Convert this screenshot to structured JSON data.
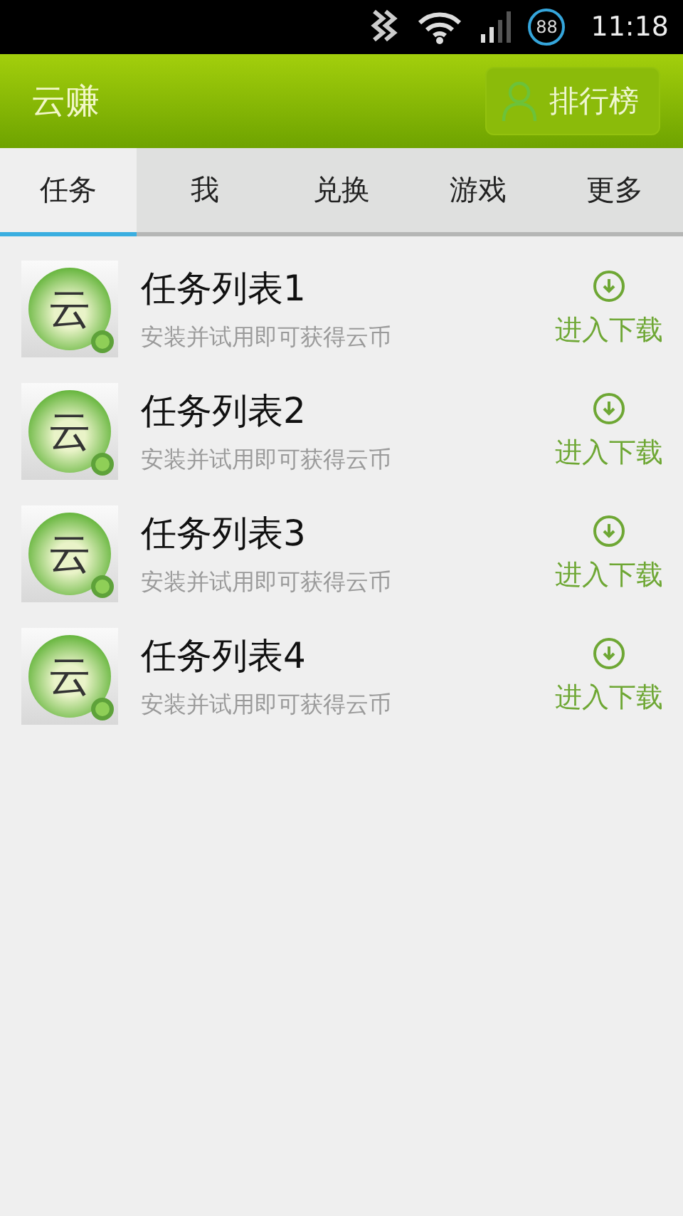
{
  "status_bar": {
    "battery": "88",
    "time": "11:18"
  },
  "header": {
    "title": "云赚",
    "ranking_button": "排行榜"
  },
  "tabs": [
    {
      "label": "任务",
      "selected": true
    },
    {
      "label": "我",
      "selected": false
    },
    {
      "label": "兑换",
      "selected": false
    },
    {
      "label": "游戏",
      "selected": false
    },
    {
      "label": "更多",
      "selected": false
    }
  ],
  "tasks": [
    {
      "logo": "云",
      "title": "任务列表1",
      "subtitle": "安装并试用即可获得云币",
      "action": "进入下载"
    },
    {
      "logo": "云",
      "title": "任务列表2",
      "subtitle": "安装并试用即可获得云币",
      "action": "进入下载"
    },
    {
      "logo": "云",
      "title": "任务列表3",
      "subtitle": "安装并试用即可获得云币",
      "action": "进入下载"
    },
    {
      "logo": "云",
      "title": "任务列表4",
      "subtitle": "安装并试用即可获得云币",
      "action": "进入下载"
    }
  ]
}
